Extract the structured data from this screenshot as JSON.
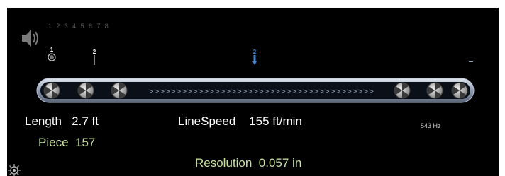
{
  "channels": [
    "1",
    "2",
    "3",
    "4",
    "5",
    "6",
    "7",
    "8"
  ],
  "markers": [
    {
      "label": "1"
    },
    {
      "label": "2"
    },
    {
      "label": "2"
    }
  ],
  "belt": {
    "arrows": ">>>>>>>>>>>>>>>>>>>>>>>>>>>>>>>>>>>>>>>>>"
  },
  "length": {
    "label": "Length",
    "value": "2.7 ft"
  },
  "piece": {
    "label": "Piece",
    "value": "157"
  },
  "linespeed": {
    "label": "LineSpeed",
    "value": "155 ft/min"
  },
  "resolution": {
    "label": "Resolution",
    "value": "0.057 in"
  },
  "frequency": "543 Hz",
  "colors": {
    "background": "#000000",
    "text": "#ffffff",
    "green_text": "#c8e0a0",
    "marker_blue": "#3a86d8",
    "belt": "#9aa6b8"
  }
}
